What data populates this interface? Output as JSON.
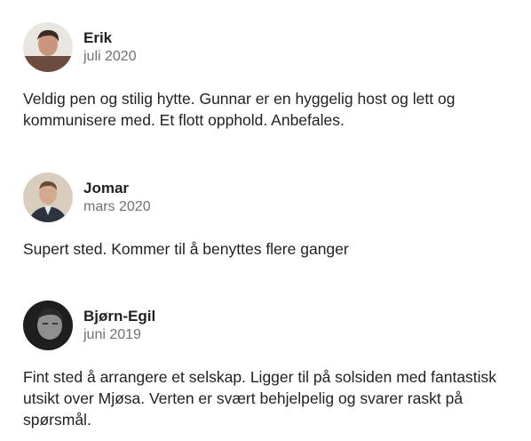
{
  "reviews": [
    {
      "name": "Erik",
      "date": "juli 2020",
      "text": "Veldig pen og stilig hytte. Gunnar er en hyggelig host og lett og kommunisere med. Et flott opphold. Anbefales."
    },
    {
      "name": "Jomar",
      "date": "mars 2020",
      "text": "Supert sted. Kommer til å benyttes flere ganger"
    },
    {
      "name": "Bjørn-Egil",
      "date": "juni 2019",
      "text": "Fint sted å arrangere et selskap. Ligger til på solsiden med fantastisk utsikt over Mjøsa. Verten er svært behjelpelig og svarer raskt på spørsmål."
    }
  ]
}
